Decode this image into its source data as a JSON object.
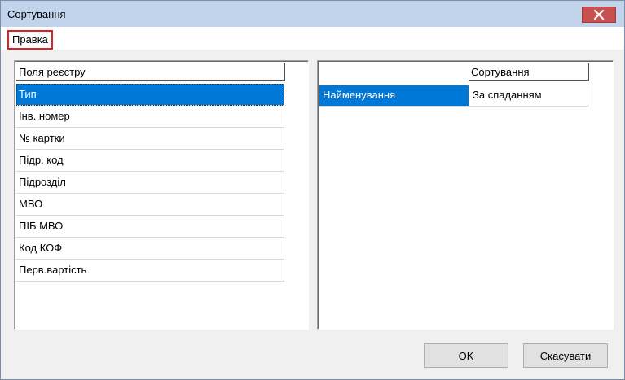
{
  "window": {
    "title": "Сортування",
    "close_glyph": "✕",
    "accent": "#0078d7",
    "close_color": "#c75050"
  },
  "menu": {
    "items": [
      {
        "label": "Правка"
      }
    ]
  },
  "registry_fields": {
    "header": "Поля реєстру",
    "selected_index": 0,
    "items": [
      "Тип",
      "Інв. номер",
      "№ картки",
      "Підр. код",
      "Підрозділ",
      "МВО",
      "ПІБ МВО",
      "Код КОФ",
      "Перв.вартість"
    ]
  },
  "sorting": {
    "header": "Сортування",
    "rows": [
      {
        "field": "Найменування",
        "order": "За спаданням"
      }
    ]
  },
  "buttons": {
    "ok": "OK",
    "cancel": "Скасувати"
  }
}
